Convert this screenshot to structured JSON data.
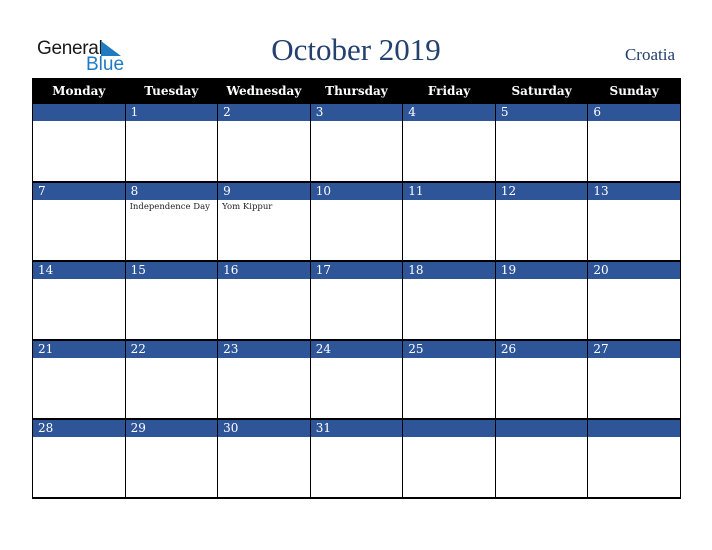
{
  "logo": {
    "word1": "General",
    "word2": "Blue",
    "brand_color": "#1f7ac2"
  },
  "header": {
    "title": "October 2019",
    "country": "Croatia"
  },
  "colors": {
    "header_bg": "#000000",
    "band_bg": "#2e5597",
    "title_color": "#23406e"
  },
  "weekdays": [
    "Monday",
    "Tuesday",
    "Wednesday",
    "Thursday",
    "Friday",
    "Saturday",
    "Sunday"
  ],
  "weeks": [
    {
      "days": [
        "",
        "1",
        "2",
        "3",
        "4",
        "5",
        "6"
      ],
      "events": [
        "",
        "",
        "",
        "",
        "",
        "",
        ""
      ]
    },
    {
      "days": [
        "7",
        "8",
        "9",
        "10",
        "11",
        "12",
        "13"
      ],
      "events": [
        "",
        "Independence Day",
        "Yom Kippur",
        "",
        "",
        "",
        ""
      ]
    },
    {
      "days": [
        "14",
        "15",
        "16",
        "17",
        "18",
        "19",
        "20"
      ],
      "events": [
        "",
        "",
        "",
        "",
        "",
        "",
        ""
      ]
    },
    {
      "days": [
        "21",
        "22",
        "23",
        "24",
        "25",
        "26",
        "27"
      ],
      "events": [
        "",
        "",
        "",
        "",
        "",
        "",
        ""
      ]
    },
    {
      "days": [
        "28",
        "29",
        "30",
        "31",
        "",
        "",
        ""
      ],
      "events": [
        "",
        "",
        "",
        "",
        "",
        "",
        ""
      ]
    }
  ]
}
